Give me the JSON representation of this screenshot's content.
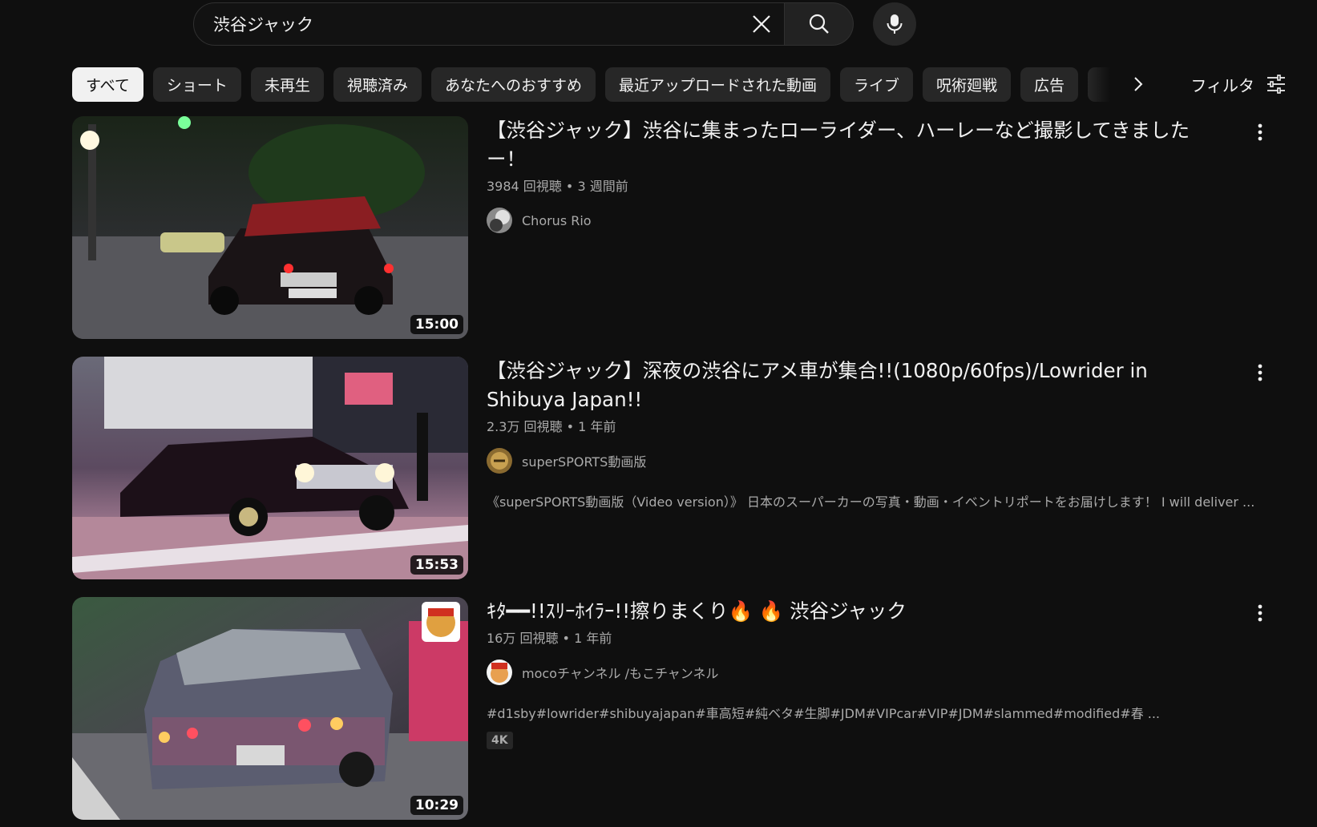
{
  "search": {
    "query": "渋谷ジャック",
    "clear_icon": "close-icon",
    "search_icon": "search-icon",
    "mic_icon": "microphone-icon"
  },
  "chips": [
    "すべて",
    "ショート",
    "未再生",
    "視聴済み",
    "あなたへのおすすめ",
    "最近アップロードされた動画",
    "ライブ",
    "呪術廻戦",
    "広告"
  ],
  "filter": {
    "label": "フィルタ",
    "icon": "sliders-icon"
  },
  "results": [
    {
      "title": "【渋谷ジャック】渋谷に集まったローライダー、ハーレーなど撮影してきました ー！",
      "views": "3984 回視聴",
      "age": "3 週間前",
      "channel": "Chorus Rio",
      "duration": "15:00",
      "description": "",
      "badge": ""
    },
    {
      "title": "【渋谷ジャック】深夜の渋谷にアメ車が集合!!(1080p/60fps)/Lowrider in Shibuya Japan!!",
      "views": "2.3万 回視聴",
      "age": "1 年前",
      "channel": "superSPORTS動画版",
      "duration": "15:53",
      "description": "《superSPORTS動画版（Video version）》 日本のスーパーカーの写真・動画・イベントリポートをお届けします！ I will deliver ...",
      "badge": ""
    },
    {
      "title": "ｷﾀ━━!!ｽﾘｰﾎｲﾗｰ!!擦りまくり🔥 🔥 渋谷ジャック",
      "views": "16万 回視聴",
      "age": "1 年前",
      "channel": "mocoチャンネル /もこチャンネル",
      "duration": "10:29",
      "description": "#d1sby#lowrider#shibuyajapan#車高短#純ベタ#生脚#JDM#VIPcar#VIP#JDM#slammed#modified#春 ...",
      "badge": "4K"
    }
  ],
  "colors": {
    "background": "#0f0f0f",
    "chip": "#272727",
    "chip_active": "#f1f1f1",
    "text_primary": "#f1f1f1",
    "text_secondary": "#aaaaaa"
  }
}
